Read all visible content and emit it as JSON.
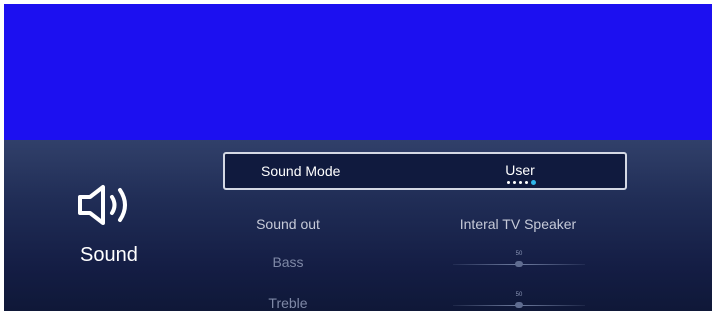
{
  "menu": {
    "category": {
      "icon": "speaker-icon",
      "label": "Sound"
    },
    "rows": {
      "sound_mode": {
        "label": "Sound Mode",
        "value": "User",
        "page_indicator": {
          "count": 5,
          "active_index": 4
        }
      },
      "sound_out": {
        "label": "Sound out",
        "value": "Interal TV Speaker"
      },
      "bass": {
        "label": "Bass",
        "value": "50",
        "level": 0.5
      },
      "treble": {
        "label": "Treble",
        "value": "50",
        "level": 0.5
      }
    }
  },
  "colors": {
    "video_background": "#1c10f0",
    "panel_background": "#1a2450",
    "focus_border": "#d4d8e4",
    "indicator_active": "#2fb6ea"
  }
}
